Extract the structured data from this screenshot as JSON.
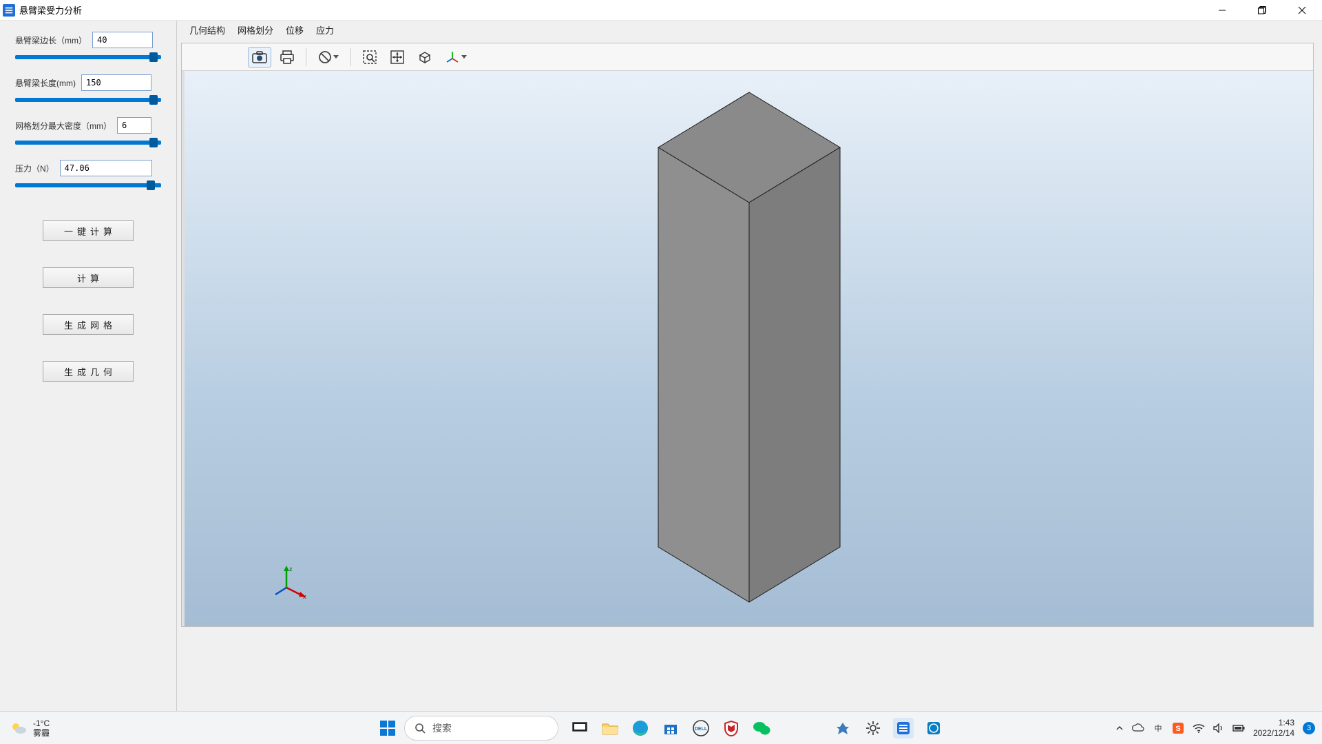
{
  "window": {
    "title": "悬臂梁受力分析"
  },
  "sidebar": {
    "param1": {
      "label": "悬臂梁边长（mm）",
      "value": "40",
      "pct": 92
    },
    "param2": {
      "label": "悬臂梁长度(mm)",
      "value": "150",
      "pct": 92
    },
    "param3": {
      "label": "网格划分最大密度（mm）",
      "value": "6",
      "pct": 92
    },
    "param4": {
      "label": "压力（N）",
      "value": "47.06",
      "pct": 90
    },
    "buttons": {
      "b1": "一键计算",
      "b2": "计算",
      "b3": "生成网格",
      "b4": "生成几何"
    }
  },
  "tabs": {
    "t1": "几何结构",
    "t2": "网格划分",
    "t3": "位移",
    "t4": "应力"
  },
  "search": {
    "placeholder": "搜索"
  },
  "weather": {
    "temp": "-1°C",
    "desc": "雾霾"
  },
  "clock": {
    "time": "1:43",
    "date": "2022/12/14"
  },
  "notif_count": "3"
}
